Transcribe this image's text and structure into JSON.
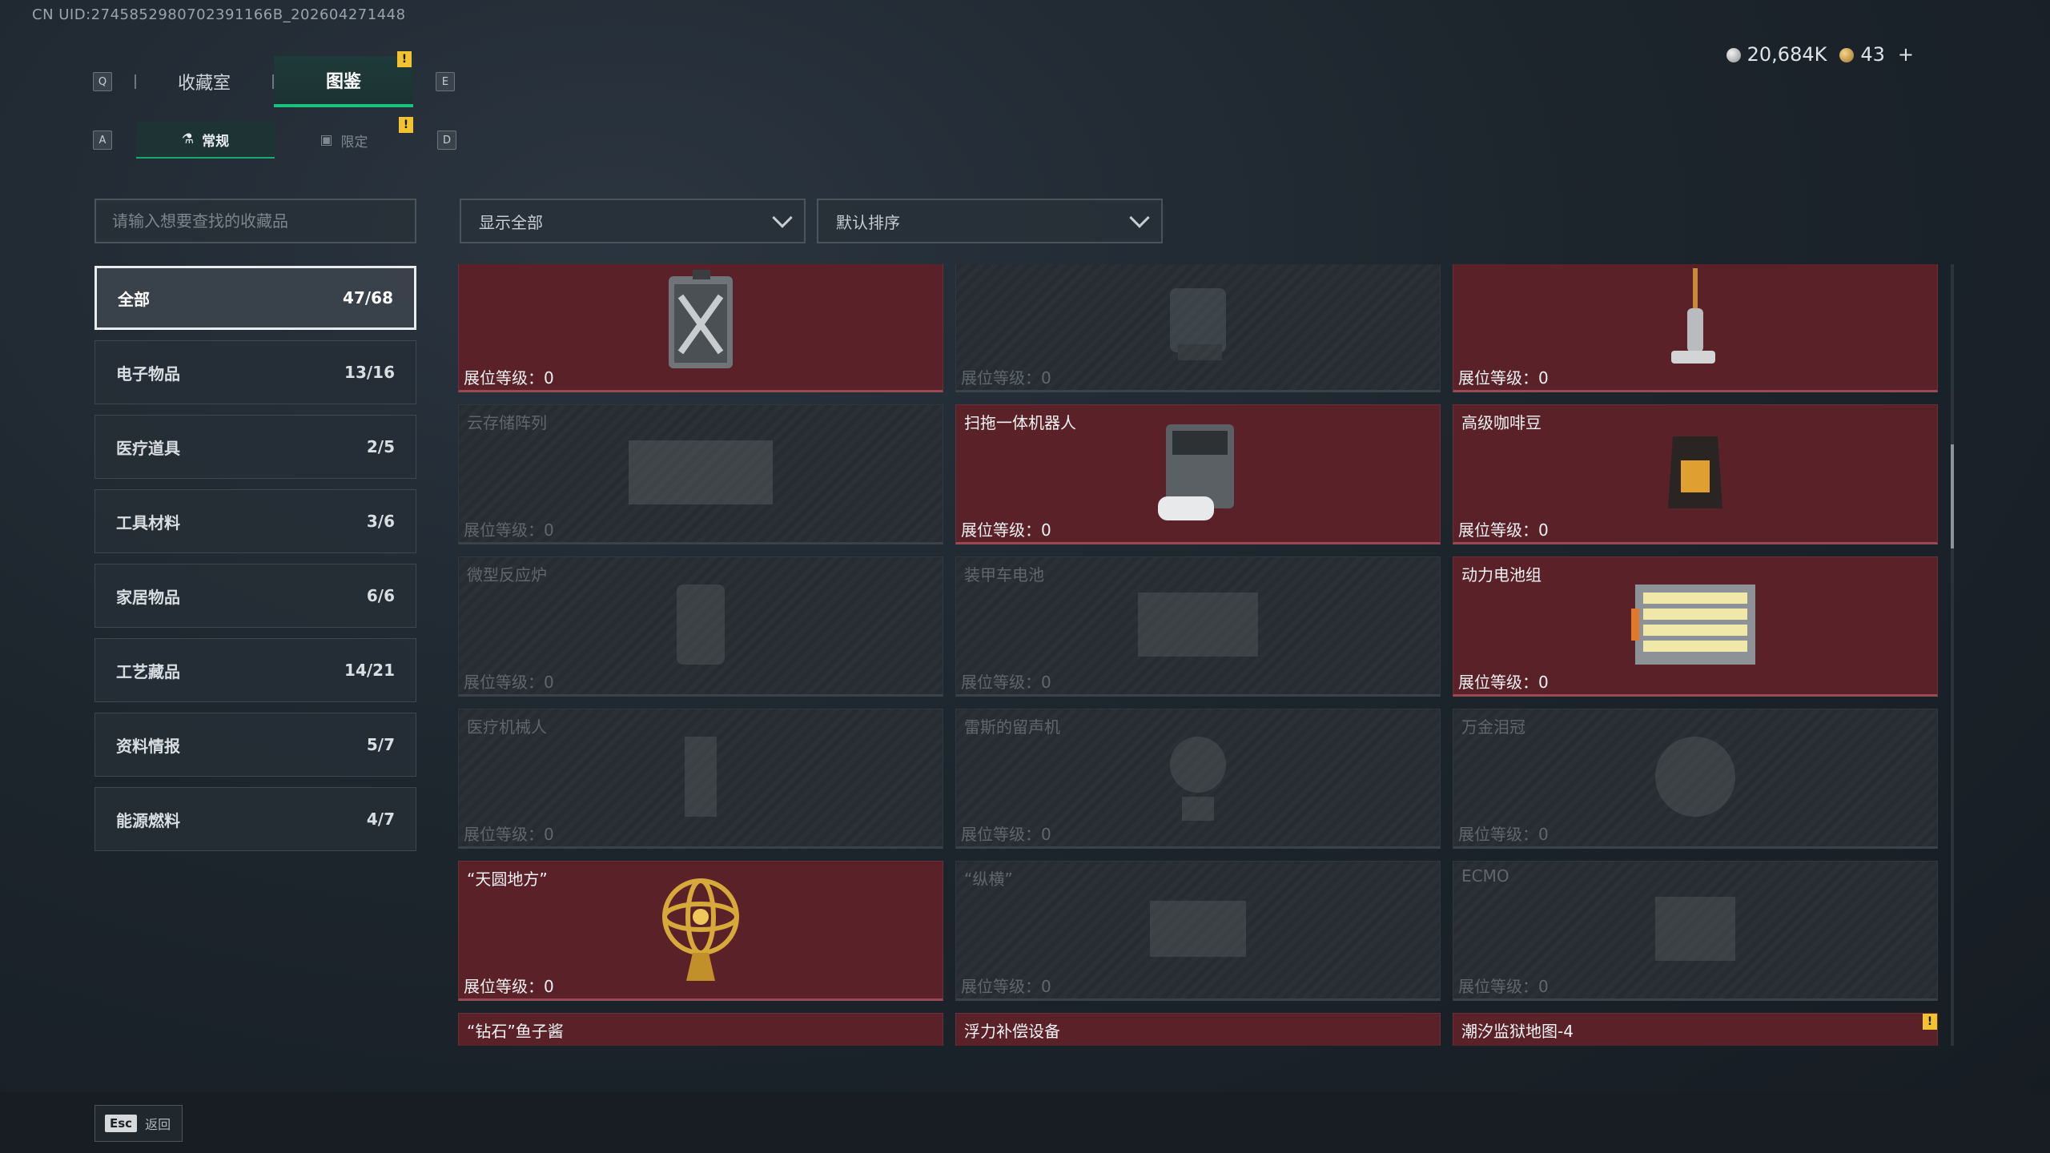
{
  "uid": "CN UID:2745852980702391166B_202604271448",
  "tabs": {
    "main": [
      {
        "label": "收藏室",
        "key": "Q"
      },
      {
        "label": "图鉴",
        "key": "E"
      }
    ],
    "sub": [
      {
        "label": "常规",
        "key": "A"
      },
      {
        "label": "限定",
        "key": "D"
      }
    ],
    "badge": "!"
  },
  "currency": {
    "silver": "20,684K",
    "gold": "43",
    "plus": "+"
  },
  "search": {
    "placeholder": "请输入想要查找的收藏品"
  },
  "filters": {
    "display": "显示全部",
    "sort": "默认排序"
  },
  "categories": [
    {
      "label": "全部",
      "count": "47/68"
    },
    {
      "label": "电子物品",
      "count": "13/16"
    },
    {
      "label": "医疗道具",
      "count": "2/5"
    },
    {
      "label": "工具材料",
      "count": "3/6"
    },
    {
      "label": "家居物品",
      "count": "6/6"
    },
    {
      "label": "工艺藏品",
      "count": "14/21"
    },
    {
      "label": "资料情报",
      "count": "5/7"
    },
    {
      "label": "能源燃料",
      "count": "4/7"
    }
  ],
  "items": [
    {
      "name": "",
      "level": "展位等级：0",
      "owned": true,
      "icon": "fuel-can-icon"
    },
    {
      "name": "",
      "level": "展位等级：0",
      "owned": false,
      "icon": "device-icon"
    },
    {
      "name": "",
      "level": "展位等级：0",
      "owned": true,
      "icon": "floor-washer-icon"
    },
    {
      "name": "云存储阵列",
      "level": "展位等级：0",
      "owned": false,
      "icon": "storage-array-icon"
    },
    {
      "name": "扫拖一体机器人",
      "level": "展位等级：0",
      "owned": true,
      "icon": "robot-vacuum-icon"
    },
    {
      "name": "高级咖啡豆",
      "level": "展位等级：0",
      "owned": true,
      "icon": "coffee-bag-icon"
    },
    {
      "name": "微型反应炉",
      "level": "展位等级：0",
      "owned": false,
      "icon": "reactor-icon"
    },
    {
      "name": "装甲车电池",
      "level": "展位等级：0",
      "owned": false,
      "icon": "battery-icon"
    },
    {
      "name": "动力电池组",
      "level": "展位等级：0",
      "owned": true,
      "icon": "battery-pack-icon"
    },
    {
      "name": "医疗机械人",
      "level": "展位等级：0",
      "owned": false,
      "icon": "medical-robot-icon"
    },
    {
      "name": "雷斯的留声机",
      "level": "展位等级：0",
      "owned": false,
      "icon": "gramophone-icon"
    },
    {
      "name": "万金泪冠",
      "level": "展位等级：0",
      "owned": false,
      "icon": "crown-icon"
    },
    {
      "name": "“天圆地方”",
      "level": "展位等级：0",
      "owned": true,
      "icon": "armillary-sphere-icon"
    },
    {
      "name": "“纵横”",
      "level": "展位等级：0",
      "owned": false,
      "icon": "chessboard-icon"
    },
    {
      "name": "ECMO",
      "level": "展位等级：0",
      "owned": false,
      "icon": "ecmo-icon"
    },
    {
      "name": "“钻石”鱼子酱",
      "level": "",
      "owned": true,
      "icon": "caviar-tin-icon"
    },
    {
      "name": "浮力补偿设备",
      "level": "",
      "owned": true,
      "icon": "bcd-icon"
    },
    {
      "name": "潮汐监狱地图-4",
      "level": "",
      "owned": true,
      "icon": "map-icon",
      "badge": "!"
    }
  ],
  "footer": {
    "key": "Esc",
    "label": "返回"
  }
}
